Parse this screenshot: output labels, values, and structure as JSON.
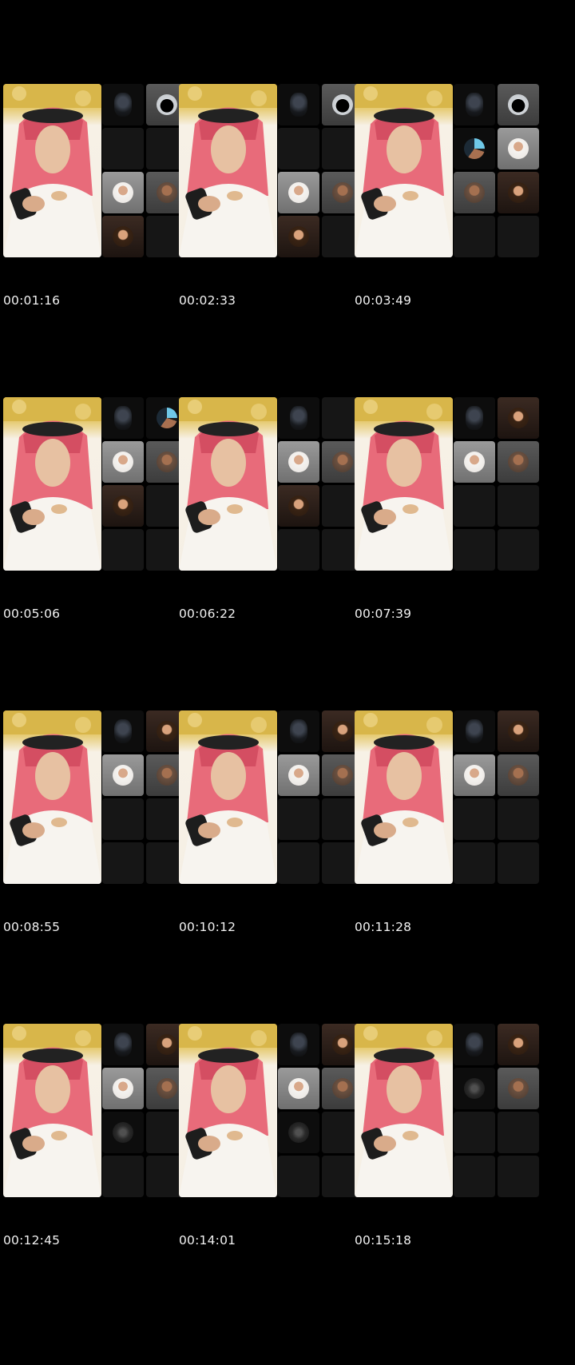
{
  "frames": [
    {
      "timestamp": "00:01:16",
      "cells": [
        "ghost",
        "dark-circle",
        "blank",
        "blank",
        "woman-light",
        "woman-dim",
        "woman-dark",
        "blank"
      ]
    },
    {
      "timestamp": "00:02:33",
      "cells": [
        "ghost",
        "dark-circle",
        "blank",
        "blank",
        "woman-light",
        "woman-dim",
        "woman-dark",
        "blank"
      ]
    },
    {
      "timestamp": "00:03:49",
      "cells": [
        "ghost",
        "dark-circle",
        "man-blue",
        "woman-light",
        "woman-dim",
        "woman-dark",
        "blank",
        "blank"
      ]
    },
    {
      "timestamp": "00:05:06",
      "cells": [
        "ghost",
        "man-blue",
        "woman-light",
        "woman-dim",
        "woman-dark",
        "blank",
        "blank",
        "blank"
      ]
    },
    {
      "timestamp": "00:06:22",
      "cells": [
        "ghost",
        "blank",
        "woman-light",
        "woman-dim",
        "woman-dark",
        "blank",
        "blank",
        "blank"
      ]
    },
    {
      "timestamp": "00:07:39",
      "cells": [
        "ghost",
        "woman-dark",
        "woman-light",
        "woman-dim",
        "blank",
        "blank",
        "blank",
        "blank"
      ]
    },
    {
      "timestamp": "00:08:55",
      "cells": [
        "ghost",
        "woman-dark",
        "woman-light",
        "woman-dim",
        "blank",
        "blank",
        "blank",
        "blank"
      ]
    },
    {
      "timestamp": "00:10:12",
      "cells": [
        "ghost",
        "woman-dark",
        "woman-light",
        "woman-dim",
        "blank",
        "blank",
        "blank",
        "blank"
      ]
    },
    {
      "timestamp": "00:11:28",
      "cells": [
        "ghost",
        "woman-dark",
        "woman-light",
        "woman-dim",
        "blank",
        "blank",
        "blank",
        "blank"
      ]
    },
    {
      "timestamp": "00:12:45",
      "cells": [
        "ghost",
        "woman-dark",
        "woman-light",
        "woman-dim",
        "moon",
        "blank",
        "blank",
        "blank"
      ]
    },
    {
      "timestamp": "00:14:01",
      "cells": [
        "ghost",
        "woman-dark",
        "woman-light",
        "woman-dim",
        "moon",
        "blank",
        "blank",
        "blank"
      ]
    },
    {
      "timestamp": "00:15:18",
      "cells": [
        "ghost",
        "woman-dark",
        "moon",
        "woman-dim",
        "blank",
        "blank",
        "blank",
        "blank"
      ]
    }
  ],
  "colors": {
    "background": "#000000",
    "label": "#f2f2f2",
    "tile": "#161616"
  }
}
